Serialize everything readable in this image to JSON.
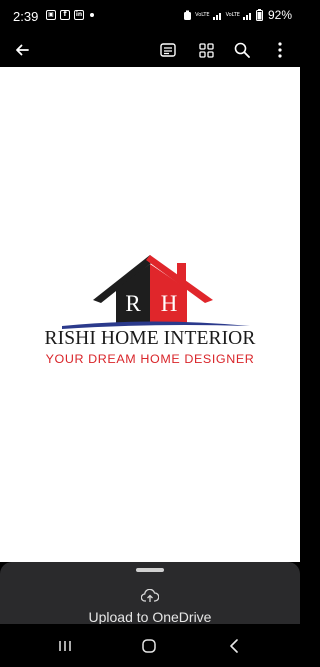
{
  "status_bar": {
    "time": "2:39",
    "notif_icons": [
      "photo-icon",
      "facebook-icon",
      "linkedin-icon"
    ],
    "signal_label_1": "VoLTE",
    "signal_label_2": "VoLTE",
    "battery_percent": "92%"
  },
  "toolbar": {
    "back_icon": "back-arrow-icon",
    "actions": [
      "text-view-icon",
      "grid-view-icon",
      "search-icon",
      "more-options-icon"
    ]
  },
  "document": {
    "logo_initials": [
      "R",
      "H"
    ],
    "brand_name": "RISHI HOME INTERIOR",
    "tagline": "YOUR DREAM HOME DESIGNER",
    "colors": {
      "dark": "#1e1e1e",
      "red": "#e0262b",
      "blue": "#2b3a8c"
    }
  },
  "bottom_sheet": {
    "upload_label": "Upload to OneDrive"
  },
  "nav_bar": {
    "buttons": [
      "recents-icon",
      "home-icon",
      "back-icon"
    ]
  }
}
